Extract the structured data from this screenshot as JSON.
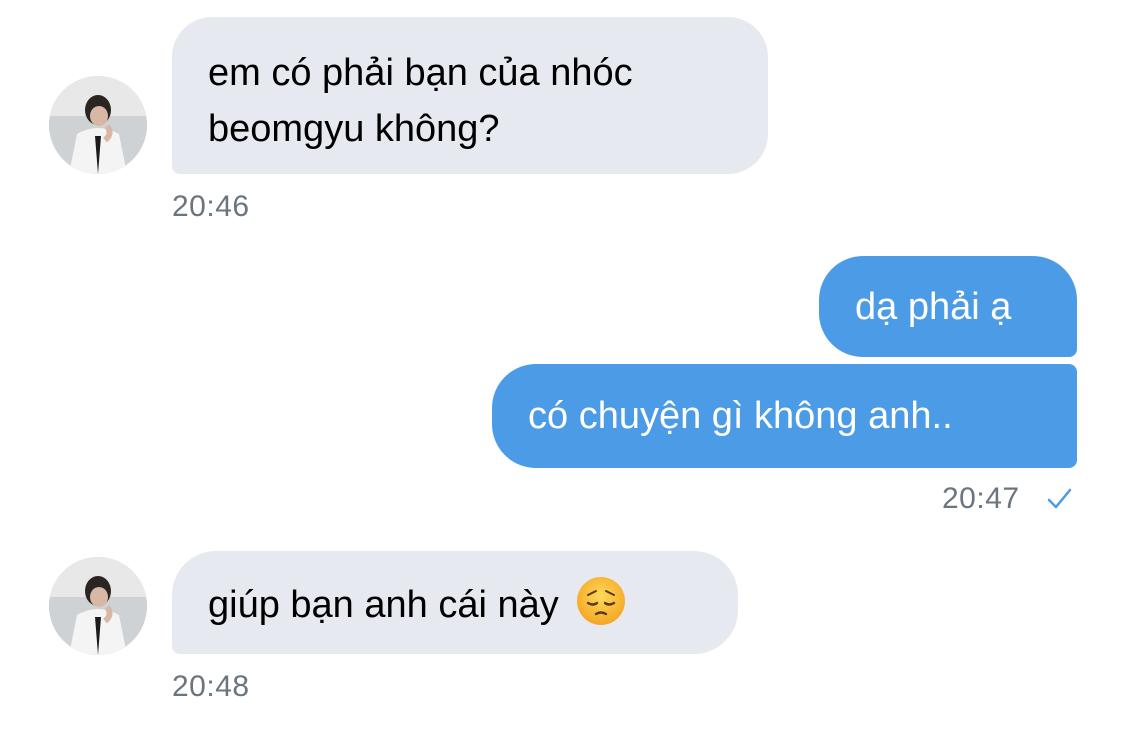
{
  "colors": {
    "incoming_bubble": "#e6e9f0",
    "outgoing_bubble": "#4b9be6",
    "timestamp": "#6b7580",
    "read_check": "#4b9be6"
  },
  "messages": [
    {
      "direction": "incoming",
      "lines": [
        "em có phải bạn của nhóc",
        "beomgyu không?"
      ],
      "time": "20:46"
    },
    {
      "direction": "outgoing",
      "lines": [
        "dạ phải ạ"
      ]
    },
    {
      "direction": "outgoing",
      "lines": [
        "có chuyện gì không anh.."
      ],
      "time": "20:47",
      "status_icon": "read-check-icon"
    },
    {
      "direction": "incoming",
      "lines": [
        "giúp bạn anh cái này"
      ],
      "emoji": "pensive-face-emoji",
      "time": "20:48"
    }
  ]
}
